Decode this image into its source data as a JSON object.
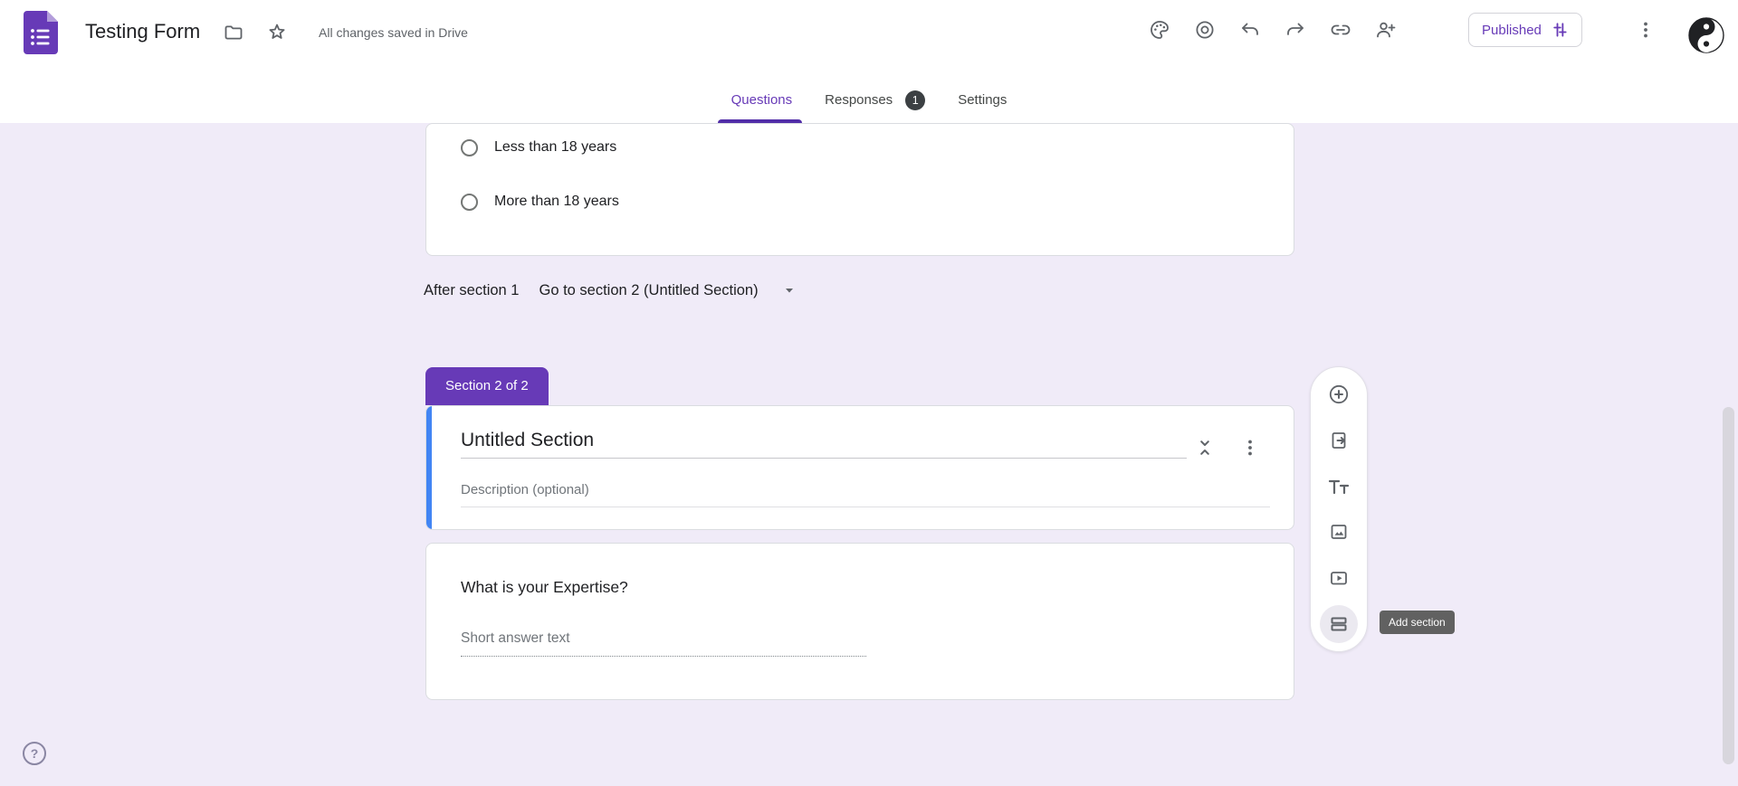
{
  "header": {
    "form_title": "Testing Form",
    "saved_status": "All changes saved in Drive",
    "published_label": "Published",
    "icons": [
      "forms-logo",
      "folder",
      "star",
      "palette",
      "preview-eye",
      "undo",
      "redo",
      "link",
      "person-add",
      "more-vertical",
      "avatar-yin-yang"
    ]
  },
  "tabs": {
    "questions": "Questions",
    "responses": "Responses",
    "responses_badge": "1",
    "settings": "Settings"
  },
  "question_card": {
    "options": [
      "Less than 18 years",
      "More than 18 years"
    ]
  },
  "branching": {
    "label": "After section 1",
    "selection": "Go to section 2 (Untitled Section)"
  },
  "section2": {
    "badge": "Section 2 of 2",
    "title": "Untitled Section",
    "description_placeholder": "Description (optional)"
  },
  "question2": {
    "title": "What is your Expertise?",
    "answer_placeholder": "Short answer text"
  },
  "side_toolbar": {
    "tooltip": "Add section",
    "icons": [
      "add-question",
      "import-questions",
      "add-title",
      "add-image",
      "add-video",
      "add-section"
    ]
  },
  "help_label": "?",
  "colors": {
    "accent": "#673ab7",
    "page_bg": "#f0ebf8",
    "selected_stripe": "#4285f4",
    "tab_underline": "#512da8",
    "responses_badge_bg": "#3c4043",
    "tooltip_bg": "#616161"
  }
}
